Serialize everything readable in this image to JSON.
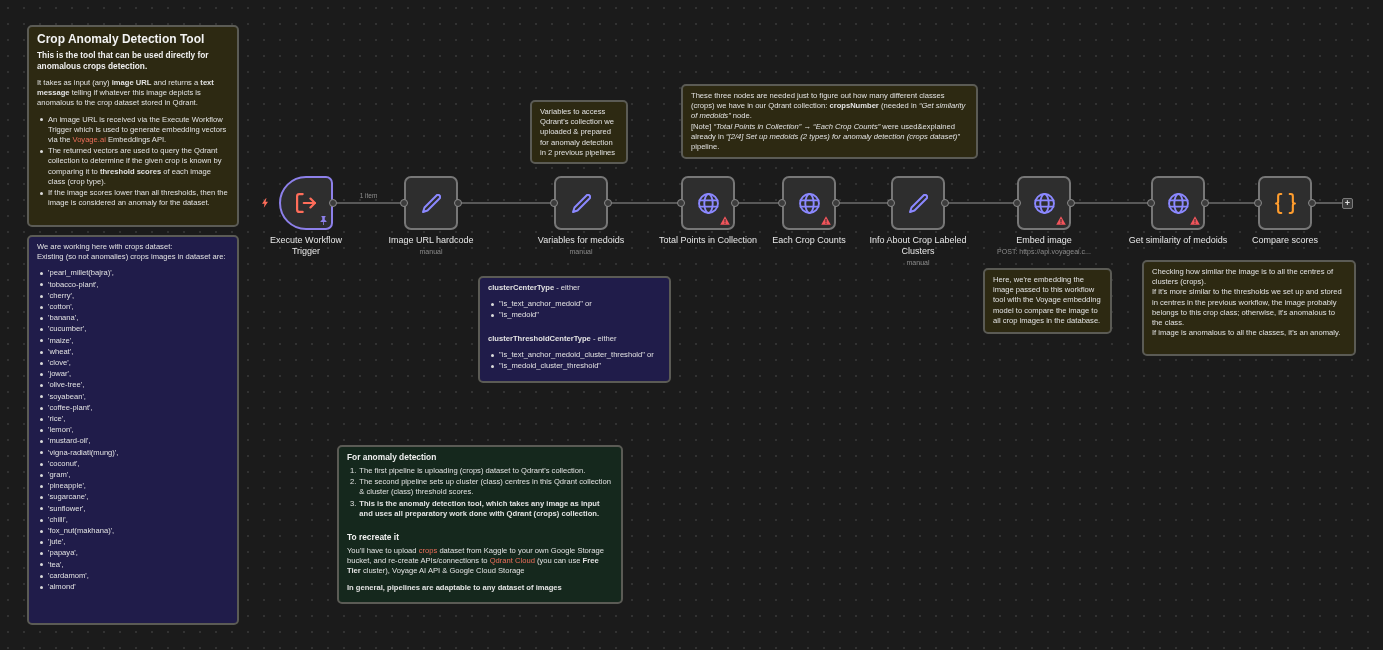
{
  "sticky_notes": [
    {
      "color": "#2d2912",
      "blocks": [
        {
          "kind": "title",
          "text": "Crop Anomaly Detection Tool"
        },
        {
          "kind": "lead",
          "text": "This is the tool that can be used directly for anomalous crops detection."
        },
        {
          "kind": "paragraph",
          "text": "It takes as input (any) **image URL** and returns a **text message** telling if whatever this image depicts is anomalous to the crop dataset stored in Qdrant."
        },
        {
          "kind": "bullets",
          "items": [
            {
              "segments": [
                {
                  "kind": "text",
                  "text": "An image URL is received via the Execute Workflow Trigger which is used to generate embedding vectors via the "
                },
                {
                  "kind": "link",
                  "text": "Voyage.ai"
                },
                {
                  "kind": "text",
                  "text": " Embeddings API."
                }
              ]
            },
            {
              "text": "The returned vectors are used to query the Qdrant collection to determine if the given crop is known by comparing it to **threshold scores** of each image class (crop type)."
            },
            {
              "text": "If the image scores lower than all thresholds, then the image is considered an anomaly for the dataset."
            }
          ]
        }
      ]
    },
    {
      "color": "#201c4a",
      "blocks": [
        {
          "kind": "paragraph",
          "text": "We are working here with crops dataset:\nExisting (so not anomalies) crops images in dataset are:"
        },
        {
          "kind": "bullets",
          "items": [
            {
              "text": "'pearl_millet(bajra)',"
            },
            {
              "text": "'tobacco-plant',"
            },
            {
              "text": "'cherry',"
            },
            {
              "text": "'cotton',"
            },
            {
              "text": "'banana',"
            },
            {
              "text": "'cucumber',"
            },
            {
              "text": "'maize',"
            },
            {
              "text": "'wheat',"
            },
            {
              "text": "'clove',"
            },
            {
              "text": "'jowar',"
            },
            {
              "text": "'olive-tree',"
            },
            {
              "text": "'soyabean',"
            },
            {
              "text": "'coffee-plant',"
            },
            {
              "text": "'rice',"
            },
            {
              "text": "'lemon',"
            },
            {
              "text": "'mustard-oil',"
            },
            {
              "text": "'vigna-radiati(mung)',"
            },
            {
              "text": "'coconut',"
            },
            {
              "text": "'gram',"
            },
            {
              "text": "'pineapple',"
            },
            {
              "text": "'sugarcane',"
            },
            {
              "text": "'sunflower',"
            },
            {
              "text": "'chilli',"
            },
            {
              "text": "'fox_nut(makhana)',"
            },
            {
              "text": "'jute',"
            },
            {
              "text": "'papaya',"
            },
            {
              "text": "'tea',"
            },
            {
              "text": "'cardamom',"
            },
            {
              "text": "'almond'"
            }
          ]
        }
      ]
    },
    {
      "color": "#2d2912",
      "blocks": [
        {
          "kind": "paragraph",
          "text": "Variables to access Qdrant's collection we uploaded & prepared for anomaly detection in 2 previous pipelines"
        }
      ]
    },
    {
      "color": "#2d2912",
      "blocks": [
        {
          "kind": "paragraph",
          "text": "These three nodes are needed just to figure out how many different classes (crops) we have in our Qdrant collection: **cropsNumber** (needed in *“Get similarity of medoids”* node.\n[Note] *“Total Points in Collection” → “Each Crop Counts”* were used&explained already in *“[2/4] Set up medoids (2 types) for anomaly detection (crops dataset)”* pipeline."
        }
      ]
    },
    {
      "color": "#201c4a",
      "blocks": [
        {
          "kind": "paragraph",
          "text": "**clusterCenterType** - either"
        },
        {
          "kind": "bullets",
          "items": [
            {
              "text": "\"is_text_anchor_medoid\" or"
            },
            {
              "text": "\"is_medoid\""
            }
          ]
        },
        {
          "kind": "paragraph",
          "text": "**clusterThresholdCenterType** - either"
        },
        {
          "kind": "bullets",
          "items": [
            {
              "text": "\"is_text_anchor_medoid_cluster_threshold\" or"
            },
            {
              "text": "\"is_medoid_cluster_threshold\""
            }
          ]
        }
      ]
    },
    {
      "color": "#2d2912",
      "blocks": [
        {
          "kind": "paragraph",
          "text": "Here, we're embedding the image passed to this workflow tool with the Voyage embedding model to compare the image to all crop images in the database."
        }
      ]
    },
    {
      "color": "#2d2912",
      "blocks": [
        {
          "kind": "paragraph",
          "text": "Checking how similar the image is to all the centres of clusters (crops).\nIf it's more similar to the thresholds we set up and stored in centres in the previous workflow, the image probably belongs to this crop class; otherwise, it's anomalous to the class.\nIf image is anomalous to all the classes, it's an anomaly."
        }
      ]
    },
    {
      "color": "#15281d",
      "blocks": [
        {
          "kind": "heading",
          "text": "For anomaly detection"
        },
        {
          "kind": "numbered",
          "items": [
            {
              "number": "1.",
              "text": "The first pipeline is uploading (crops) dataset to Qdrant's collection.",
              "bold": false
            },
            {
              "number": "2.",
              "text": "The second pipeline sets up cluster (class) centres in this Qdrant collection & cluster (class) threshold scores.",
              "bold": false
            },
            {
              "number": "3.",
              "text": "This is the anomaly detection tool, which takes any image as input and uses all preparatory work done with Qdrant (crops) collection.",
              "bold": true
            }
          ]
        },
        {
          "kind": "heading",
          "text": "To recreate it"
        },
        {
          "kind": "paragraph",
          "segments": [
            {
              "kind": "text",
              "text": "You'll have to upload "
            },
            {
              "kind": "link",
              "text": "crops"
            },
            {
              "kind": "text",
              "text": " dataset from Kaggle to your own Google Storage bucket, and re-create APIs/connections to "
            },
            {
              "kind": "link",
              "text": "Qdrant Cloud"
            },
            {
              "kind": "text",
              "text": " (you can use **Free Tier** cluster), Voyage AI API & Google Cloud Storage"
            }
          ]
        },
        {
          "kind": "strong",
          "text": "In general, pipelines are adaptable to any dataset of images"
        }
      ]
    }
  ],
  "nodes": [
    {
      "kind": "trigger",
      "label": "Execute Workflow Trigger",
      "pinned": true,
      "warning": false,
      "edge_label": "1 item"
    },
    {
      "kind": "set",
      "label": "Image URL hardcode",
      "subtitle": "manual",
      "pinned": false,
      "warning": false
    },
    {
      "kind": "set",
      "label": "Variables for medoids",
      "subtitle": "manual",
      "pinned": false,
      "warning": false
    },
    {
      "kind": "http",
      "label": "Total Points in Collection",
      "pinned": false,
      "warning": true
    },
    {
      "kind": "http",
      "label": "Each Crop Counts",
      "pinned": false,
      "warning": true
    },
    {
      "kind": "set",
      "label": "Info About Crop Labeled Clusters",
      "subtitle": "manual",
      "pinned": false,
      "warning": false
    },
    {
      "kind": "http",
      "label": "Embed image",
      "subtitle": "POST: https://api.voyageai.c...",
      "pinned": false,
      "warning": true
    },
    {
      "kind": "http",
      "label": "Get similarity of medoids",
      "pinned": false,
      "warning": true
    },
    {
      "kind": "code",
      "label": "Compare scores",
      "pinned": false,
      "warning": false,
      "add_button": "+"
    }
  ]
}
